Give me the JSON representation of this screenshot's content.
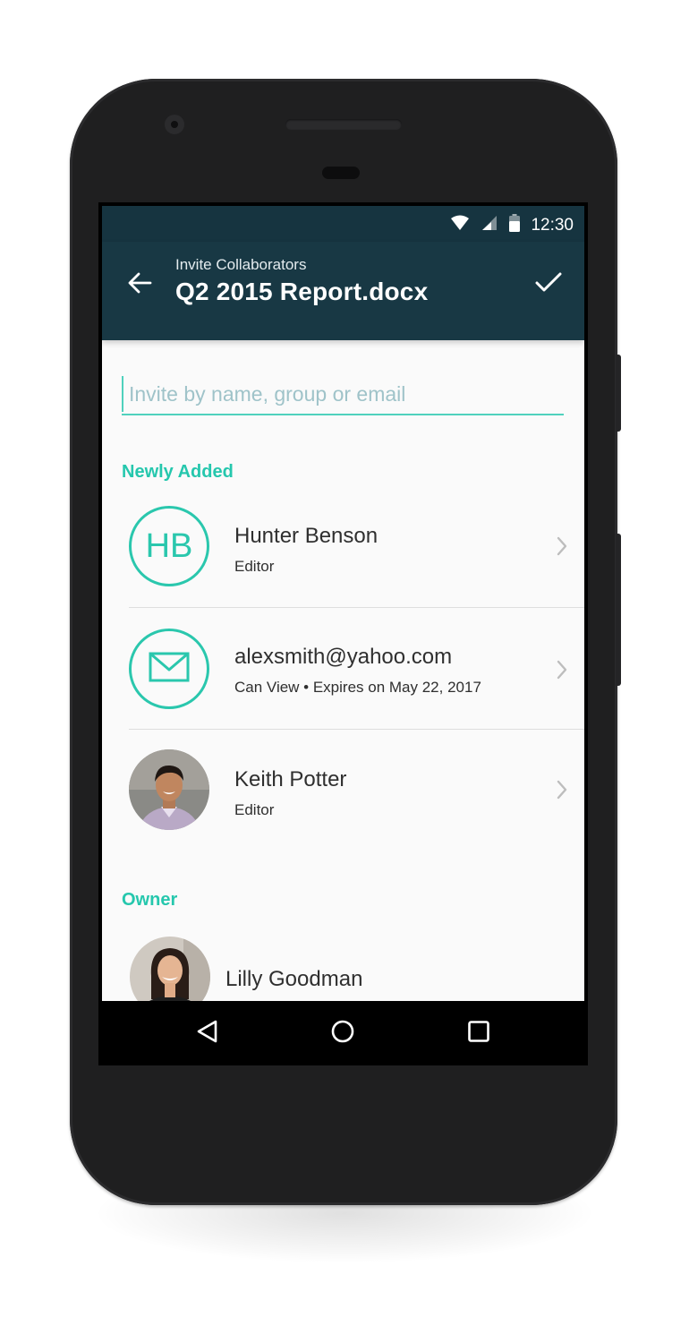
{
  "status_bar": {
    "time": "12:30",
    "icons": [
      "wifi-icon",
      "cell-signal-icon",
      "battery-icon"
    ]
  },
  "app_bar": {
    "subtitle": "Invite Collaborators",
    "title": "Q2 2015 Report.docx",
    "back_icon": "arrow-left-icon",
    "confirm_icon": "check-icon"
  },
  "invite": {
    "placeholder": "Invite by name, group or email",
    "value": ""
  },
  "sections": {
    "newly_added": {
      "label": "Newly Added",
      "items": [
        {
          "avatar": "HB",
          "name": "Hunter Benson",
          "detail": "Editor"
        },
        {
          "avatar": "mail-icon",
          "name": "alexsmith@yahoo.com",
          "detail": "Can View • Expires on May 22, 2017"
        },
        {
          "avatar": "photo",
          "name": "Keith Potter",
          "detail": "Editor"
        }
      ]
    },
    "owner": {
      "label": "Owner",
      "items": [
        {
          "avatar": "photo",
          "name": "Lilly Goodman"
        }
      ]
    }
  },
  "nav_bar": {
    "icons": [
      "back-triangle-icon",
      "home-circle-icon",
      "recents-square-icon"
    ]
  },
  "colors": {
    "status_bar": "#163440",
    "app_bar": "#183844",
    "accent": "#2ac7ad",
    "content_bg": "#fafafa",
    "device": "#1f1f20"
  }
}
